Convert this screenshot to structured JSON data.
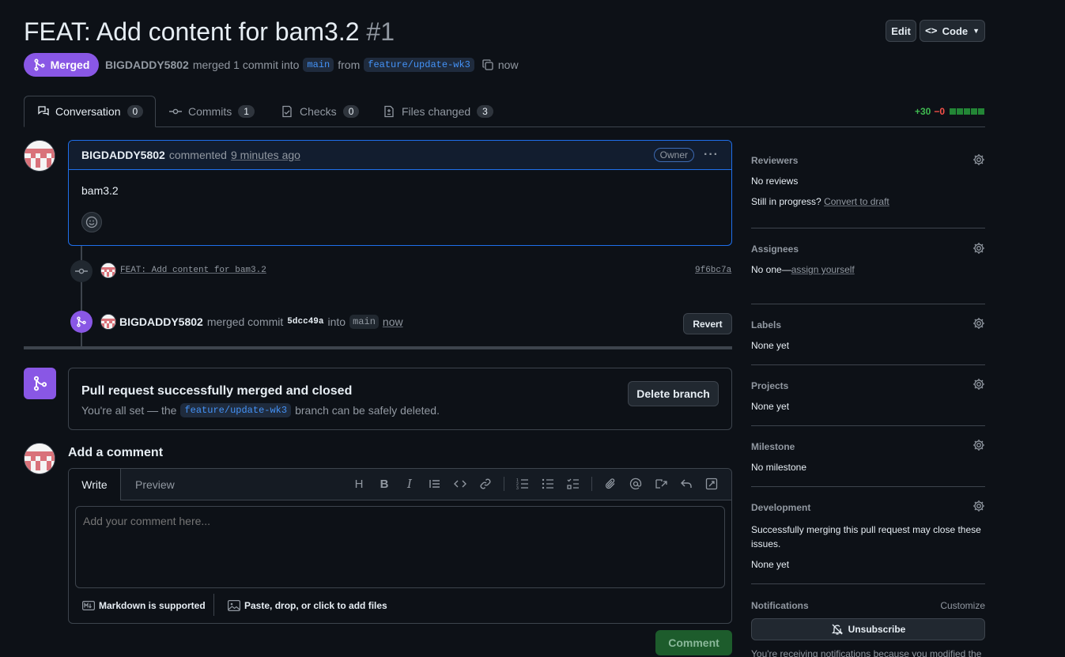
{
  "header": {
    "title": "FEAT: Add content for bam3.2",
    "number": "#1",
    "edit_label": "Edit",
    "code_label": "Code",
    "state_label": "Merged",
    "author": "BIGDADDY5802",
    "merge_text": "merged 1 commit into",
    "base_branch": "main",
    "from_text": "from",
    "head_branch": "feature/update-wk3",
    "time": "now"
  },
  "tabs": [
    {
      "label": "Conversation",
      "count": "0"
    },
    {
      "label": "Commits",
      "count": "1"
    },
    {
      "label": "Checks",
      "count": "0"
    },
    {
      "label": "Files changed",
      "count": "3"
    }
  ],
  "diffstat": {
    "additions": "+30",
    "deletions": "−0"
  },
  "comment": {
    "author": "BIGDADDY5802",
    "action": "commented",
    "time": "9 minutes ago",
    "badge": "Owner",
    "body": "bam3.2"
  },
  "timeline": {
    "commit_message": "FEAT: Add content for bam3.2",
    "commit_sha": "9f6bc7a",
    "merge_author": "BIGDADDY5802",
    "merge_text": "merged commit",
    "merge_sha": "5dcc49a",
    "into_text": "into",
    "merge_branch": "main",
    "merge_time": "now",
    "revert_label": "Revert"
  },
  "merged_box": {
    "title": "Pull request successfully merged and closed",
    "desc_before": "You're all set — the",
    "branch": "feature/update-wk3",
    "desc_after": "branch can be safely deleted.",
    "delete_label": "Delete branch"
  },
  "add_comment": {
    "heading": "Add a comment",
    "write_tab": "Write",
    "preview_tab": "Preview",
    "placeholder": "Add your comment here...",
    "markdown_note": "Markdown is supported",
    "files_note": "Paste, drop, or click to add files",
    "submit_label": "Comment"
  },
  "sidebar": {
    "reviewers": {
      "title": "Reviewers",
      "value": "No reviews",
      "progress_text": "Still in progress?",
      "draft_link": "Convert to draft"
    },
    "assignees": {
      "title": "Assignees",
      "value_prefix": "No one—",
      "assign_link": "assign yourself"
    },
    "labels": {
      "title": "Labels",
      "value": "None yet"
    },
    "projects": {
      "title": "Projects",
      "value": "None yet"
    },
    "milestone": {
      "title": "Milestone",
      "value": "No milestone"
    },
    "development": {
      "title": "Development",
      "desc": "Successfully merging this pull request may close these issues.",
      "value": "None yet"
    },
    "notifications": {
      "title": "Notifications",
      "customize": "Customize",
      "unsubscribe_label": "Unsubscribe",
      "note": "You're receiving notifications because you modified the open/close state."
    }
  }
}
